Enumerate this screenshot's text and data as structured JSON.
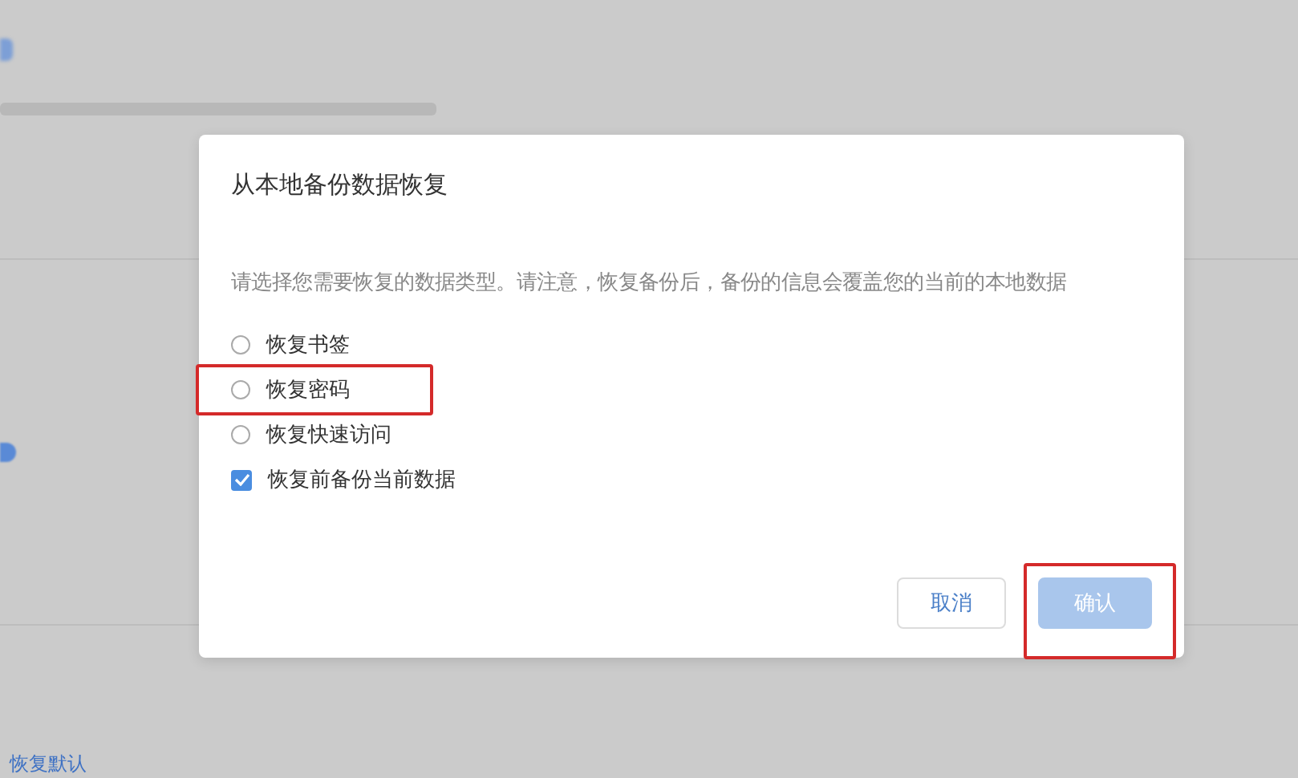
{
  "background": {
    "reset_link": "恢复默认"
  },
  "dialog": {
    "title": "从本地备份数据恢复",
    "message": "请选择您需要恢复的数据类型。请注意，恢复备份后，备份的信息会覆盖您的当前的本地数据",
    "options": [
      {
        "kind": "radio",
        "label": "恢复书签",
        "selected": false,
        "highlighted": false
      },
      {
        "kind": "radio",
        "label": "恢复密码",
        "selected": false,
        "highlighted": true
      },
      {
        "kind": "radio",
        "label": "恢复快速访问",
        "selected": false,
        "highlighted": false
      },
      {
        "kind": "checkbox",
        "label": "恢复前备份当前数据",
        "checked": true,
        "highlighted": false
      }
    ],
    "buttons": [
      {
        "kind": "secondary",
        "label": "取消",
        "disabled": false,
        "highlighted": false
      },
      {
        "kind": "primary",
        "label": "确认",
        "disabled": true,
        "highlighted": true
      }
    ]
  }
}
